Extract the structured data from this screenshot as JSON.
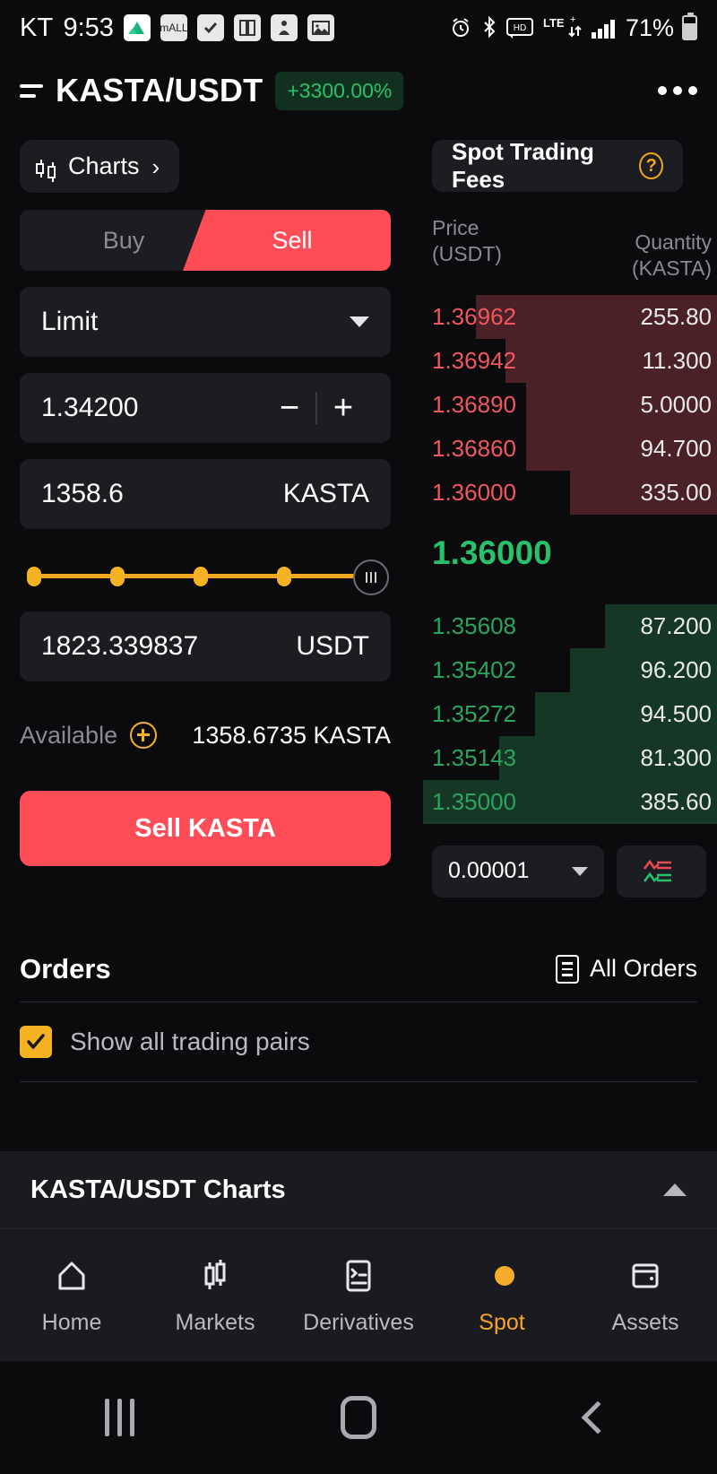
{
  "status_bar": {
    "carrier": "KT",
    "time": "9:53",
    "battery_percent": "71%",
    "network": "LTE+",
    "hd_label": "HD",
    "icons": [
      "green-mountain-app-icon",
      "mall-app-icon",
      "checkbox-app-icon",
      "panel-app-icon",
      "person-app-icon",
      "gallery-app-icon",
      "alarm-icon",
      "bluetooth-icon",
      "hd-icon",
      "lte-icon",
      "signal-icon",
      "battery-icon"
    ]
  },
  "header": {
    "menu_icon": "list-lines-icon",
    "pair": "KASTA/USDT",
    "change": "+3300.00%",
    "change_color": "#27c16b",
    "more_icon": "more-options-icon"
  },
  "charts_pill": {
    "label": "Charts",
    "icon": "candlestick-icon",
    "chevron": "›"
  },
  "order_form": {
    "tabs": [
      {
        "label": "Buy",
        "active": false
      },
      {
        "label": "Sell",
        "active": true
      }
    ],
    "order_type": "Limit",
    "price": {
      "value": "1.34200",
      "minus": "−",
      "plus": "+"
    },
    "amount": {
      "value": "1358.6",
      "unit": "KASTA"
    },
    "slider": {
      "nodes": 4,
      "position_percent": 100
    },
    "total": {
      "value": "1823.339837",
      "unit": "USDT"
    },
    "available": {
      "label": "Available",
      "value": "1358.6735 KASTA"
    },
    "submit_label": "Sell KASTA",
    "submit_color": "#ff4d57"
  },
  "order_book": {
    "fees_label": "Spot Trading Fees",
    "help_icon": "question-mark-icon",
    "columns": {
      "price": "Price",
      "price_unit": "(USDT)",
      "qty": "Quantity",
      "qty_unit": "(KASTA)"
    },
    "asks": [
      {
        "price": "1.36962",
        "qty": "255.80",
        "depth": 82
      },
      {
        "price": "1.36942",
        "qty": "11.300",
        "depth": 72
      },
      {
        "price": "1.36890",
        "qty": "5.0000",
        "depth": 65
      },
      {
        "price": "1.36860",
        "qty": "94.700",
        "depth": 65
      },
      {
        "price": "1.36000",
        "qty": "335.00",
        "depth": 50
      }
    ],
    "last_price": "1.36000",
    "last_price_color": "#27c16b",
    "bids": [
      {
        "price": "1.35608",
        "qty": "87.200",
        "depth": 38
      },
      {
        "price": "1.35402",
        "qty": "96.200",
        "depth": 50
      },
      {
        "price": "1.35272",
        "qty": "94.500",
        "depth": 62
      },
      {
        "price": "1.35143",
        "qty": "81.300",
        "depth": 74
      },
      {
        "price": "1.35000",
        "qty": "385.60",
        "depth": 100
      }
    ],
    "tick_size": "0.00001",
    "view_icon": "depth-view-icon"
  },
  "orders": {
    "title": "Orders",
    "all_orders_label": "All Orders",
    "all_orders_icon": "document-list-icon",
    "show_all_pairs_label": "Show all trading pairs",
    "show_all_pairs_checked": true,
    "checkbox_color": "#f5b324"
  },
  "charts_expander": {
    "label": "KASTA/USDT Charts",
    "arrow_icon": "chevron-up-icon"
  },
  "bottom_nav": {
    "items": [
      {
        "label": "Home",
        "icon": "home-icon",
        "active": false
      },
      {
        "label": "Markets",
        "icon": "candlestick-icon",
        "active": false
      },
      {
        "label": "Derivatives",
        "icon": "derivatives-list-icon",
        "active": false
      },
      {
        "label": "Spot",
        "icon": "spot-coins-icon",
        "active": true
      },
      {
        "label": "Assets",
        "icon": "wallet-icon",
        "active": false
      }
    ],
    "active_color": "#f5a623"
  },
  "system_nav": {
    "recents_icon": "recents-icon",
    "home_icon": "home-square-icon",
    "back_icon": "back-chevron-icon"
  }
}
